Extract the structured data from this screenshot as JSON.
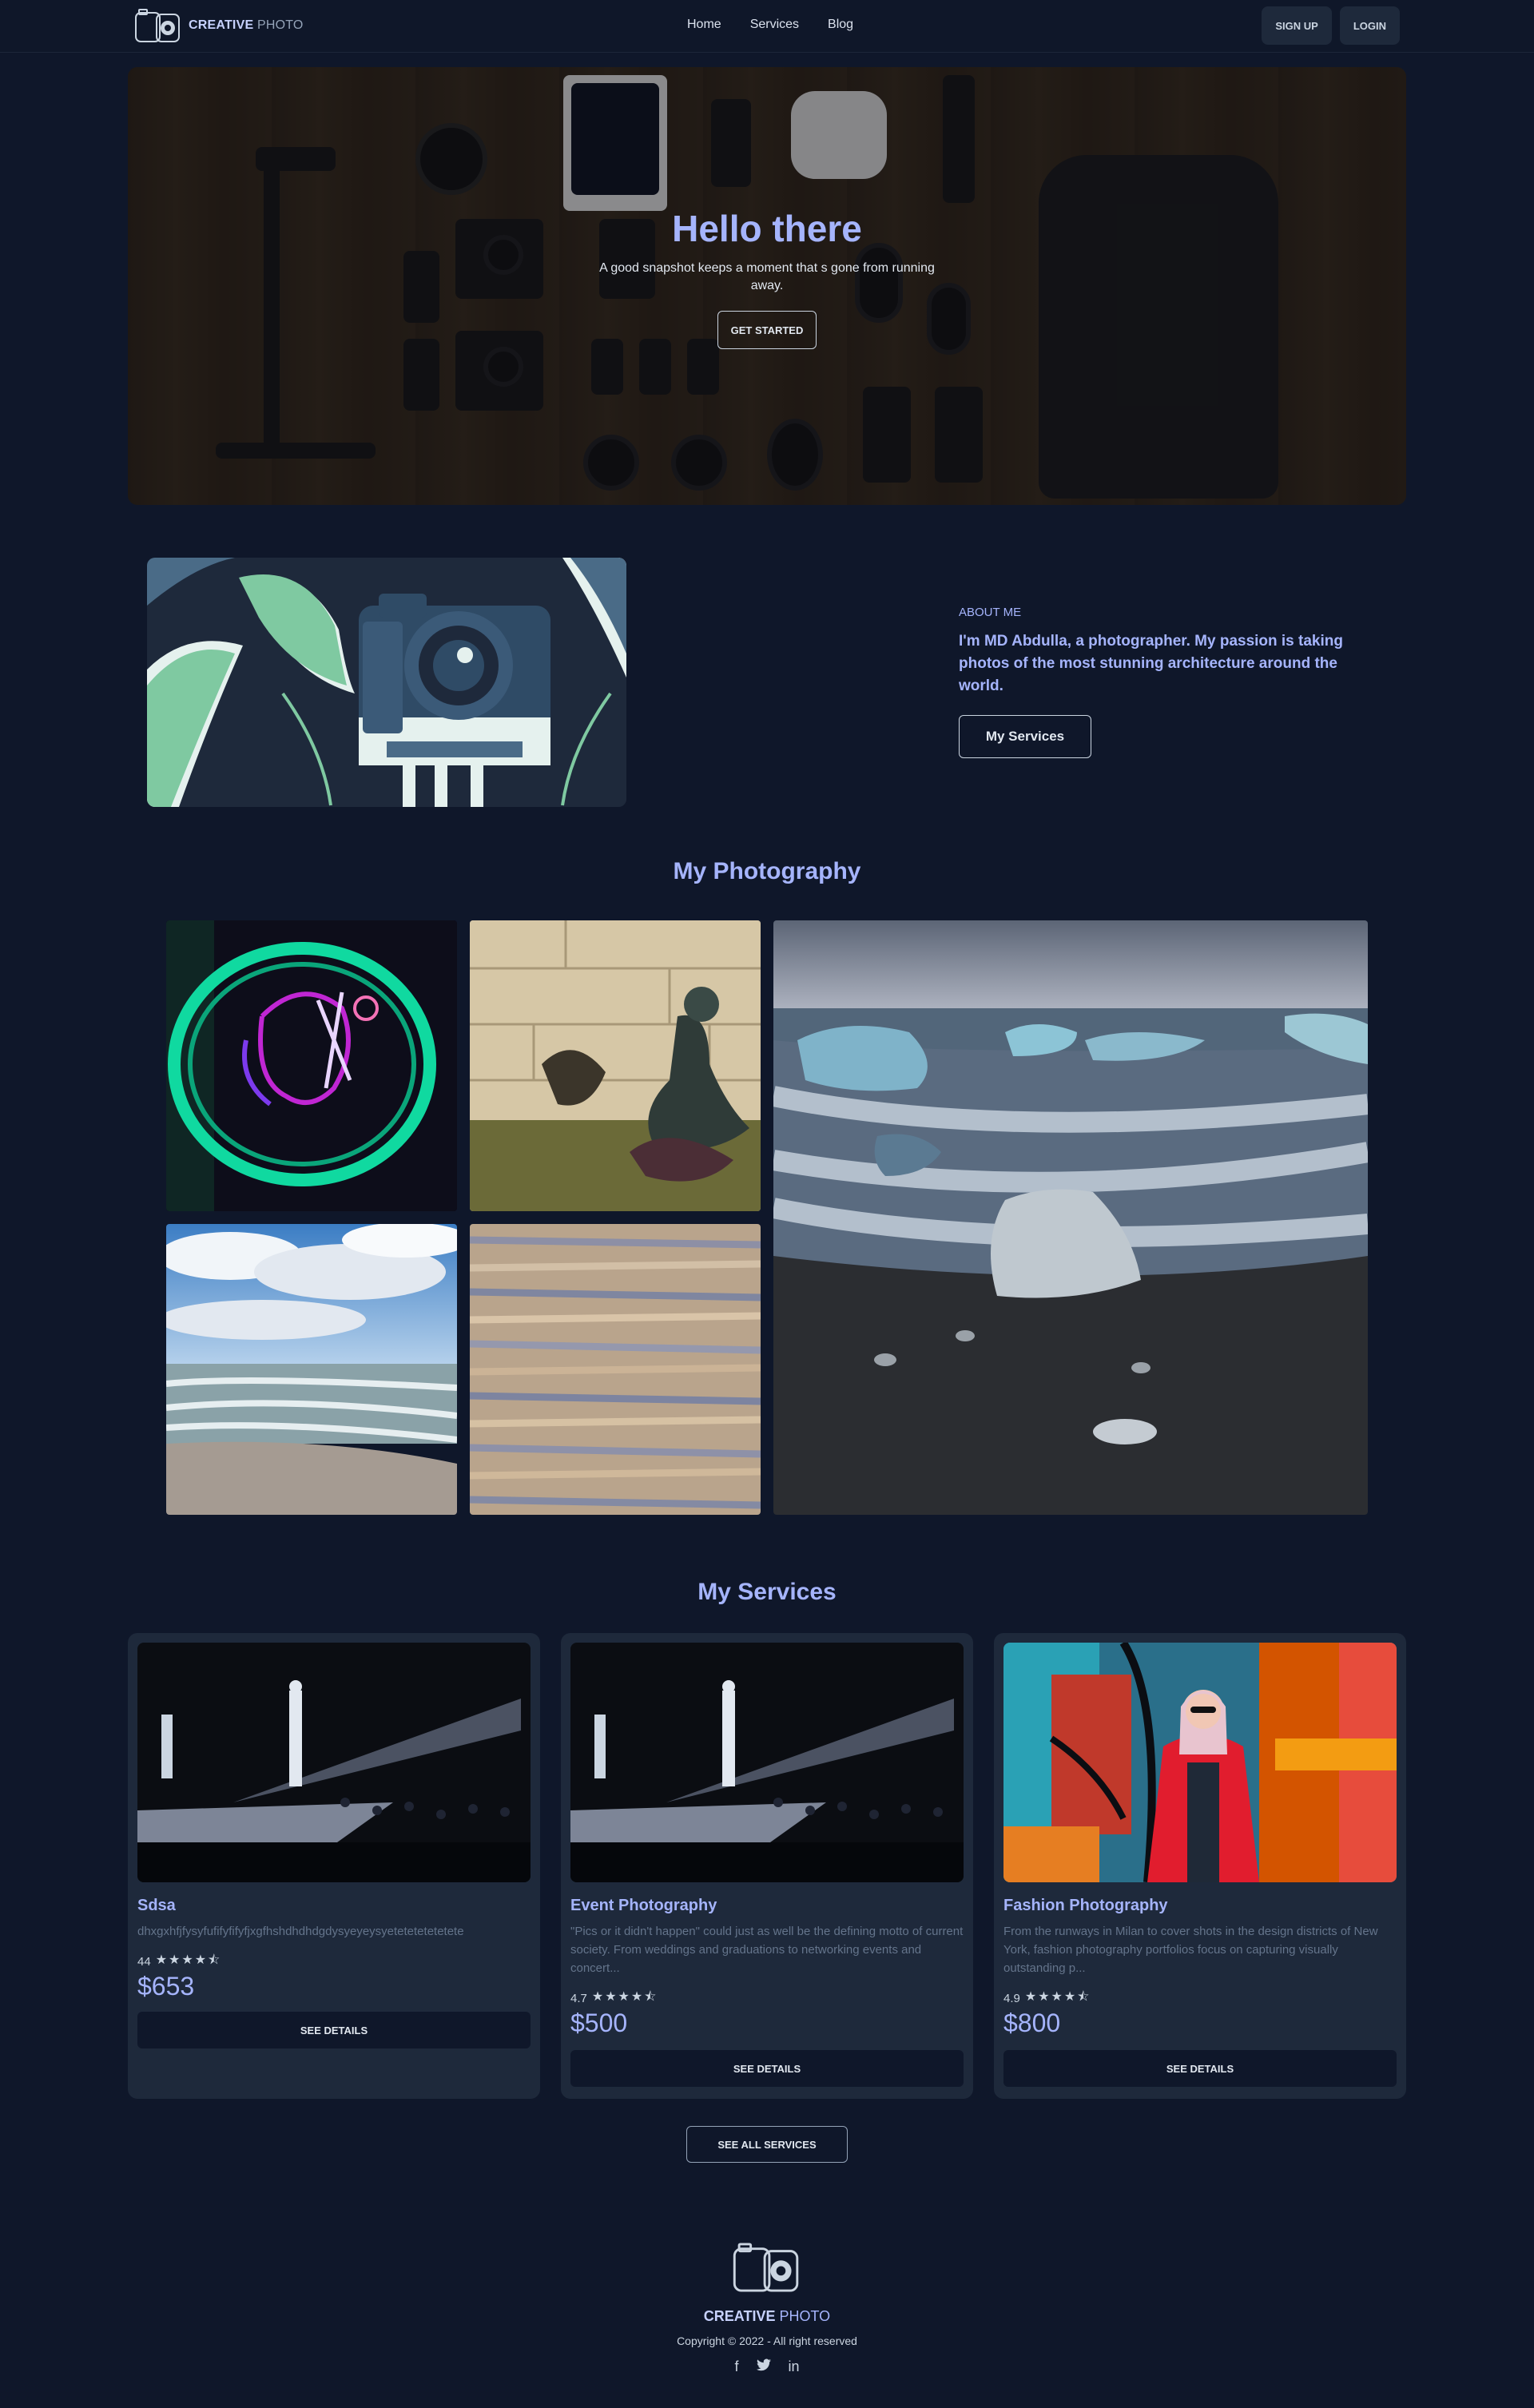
{
  "nav": {
    "brand_bold": "CREATIVE",
    "brand_light": "PHOTO",
    "links": [
      "Home",
      "Services",
      "Blog"
    ],
    "signup": "SIGN UP",
    "login": "LOGIN"
  },
  "hero": {
    "title": "Hello there",
    "subtitle": "A good snapshot keeps a moment that s gone from running away.",
    "button": "GET STARTED"
  },
  "about": {
    "label": "ABOUT ME",
    "description": "I'm MD Abdulla, a photographer. My passion is taking photos of the most stunning architecture around the world.",
    "button": "My Services"
  },
  "photography": {
    "title": "My Photography"
  },
  "services": {
    "title": "My Services",
    "cards": [
      {
        "title": "Sdsa",
        "description": "dhxgxhfjfysyfufifyfifyfjxgfhshdhdhdgdysyeyeysyetetetetetetete",
        "rating": "44",
        "stars": "★★★★⯪",
        "price": "$653",
        "button": "SEE DETAILS"
      },
      {
        "title": "Event Photography",
        "description": "\"Pics or it didn't happen\" could just as well be the defining motto of current society. From weddings and graduations to networking events and concert...",
        "rating": "4.7",
        "stars": "★★★★⯪",
        "price": "$500",
        "button": "SEE DETAILS"
      },
      {
        "title": "Fashion Photography",
        "description": "From the runways in Milan to cover shots in the design districts of New York, fashion photography portfolios focus on capturing visually outstanding p...",
        "rating": "4.9",
        "stars": "★★★★⯪",
        "price": "$800",
        "button": "SEE DETAILS"
      }
    ],
    "all_button": "SEE ALL SERVICES"
  },
  "footer": {
    "brand_bold": "CREATIVE",
    "brand_light": "PHOTO",
    "copyright": "Copyright © 2022 - All right reserved",
    "social": [
      "f",
      "t",
      "in"
    ]
  }
}
